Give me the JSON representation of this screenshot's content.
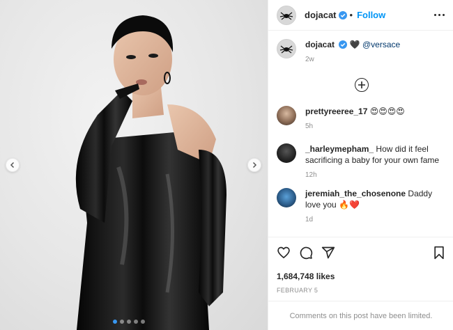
{
  "post": {
    "author": "dojacat",
    "follow_label": "Follow",
    "bullet": "•",
    "caption_emoji": "🖤",
    "caption_mention": "@versace",
    "caption_time": "2w",
    "likes": "1,684,748 likes",
    "date": "FEBRUARY 5",
    "limited_notice": "Comments on this post have been limited.",
    "carousel": {
      "total": 5,
      "active": 0
    }
  },
  "comments": [
    {
      "user": "prettyreeree_17",
      "text": "😍😍😍😍",
      "time": "5h"
    },
    {
      "user": "_harleymepham_",
      "text": "How did it feel sacrificing a baby for your own fame",
      "time": "12h"
    },
    {
      "user": "jeremiah_the_chosenone",
      "text": "Daddy love you 🔥❤️",
      "time": "1d"
    }
  ],
  "icons": {
    "more": "more-options-icon",
    "like": "heart-icon",
    "comment": "comment-icon",
    "share": "share-icon",
    "save": "bookmark-icon",
    "load_more": "plus-circle-icon"
  },
  "colors": {
    "accent": "#0095f6",
    "text": "#262626",
    "muted": "#8e8e8e",
    "border": "#efefef"
  }
}
